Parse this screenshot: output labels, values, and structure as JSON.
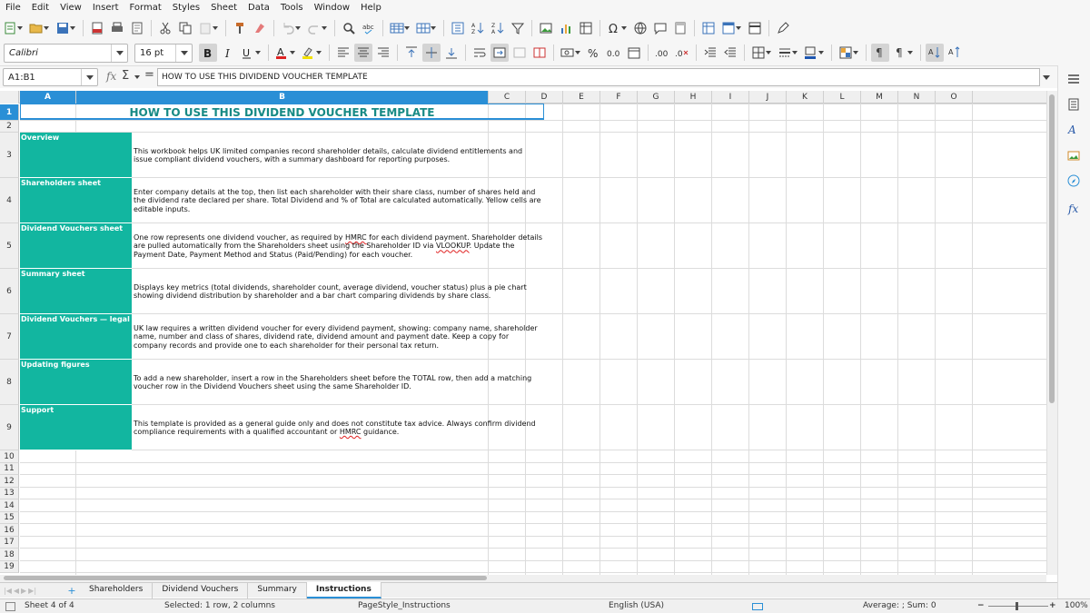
{
  "menu": [
    "File",
    "Edit",
    "View",
    "Insert",
    "Format",
    "Styles",
    "Sheet",
    "Data",
    "Tools",
    "Window",
    "Help"
  ],
  "font": {
    "name": "Calibri",
    "size": "16 pt"
  },
  "formula_bar": {
    "name_box": "A1:B1",
    "content": "HOW TO USE THIS DIVIDEND VOUCHER TEMPLATE"
  },
  "columns": [
    "A",
    "B",
    "C",
    "D",
    "E",
    "F",
    "G",
    "H",
    "I",
    "J",
    "K",
    "L",
    "M",
    "N",
    "O"
  ],
  "rows": [
    "1",
    "2",
    "3",
    "4",
    "5",
    "6",
    "7",
    "8",
    "9",
    "10",
    "11",
    "12",
    "13",
    "14",
    "15",
    "16",
    "17",
    "18",
    "19"
  ],
  "sheet": {
    "title": "HOW TO USE THIS DIVIDEND VOUCHER TEMPLATE",
    "sections": [
      {
        "label": "Overview",
        "text": "This workbook helps UK limited companies record shareholder details, calculate dividend entitlements and issue compliant dividend vouchers, with a summary dashboard for reporting purposes."
      },
      {
        "label": "Shareholders sheet",
        "text": "Enter company details at the top, then list each shareholder with their share class, number of shares held and the dividend rate declared per share. Total Dividend and % of Total are calculated automatically. Yellow cells are editable inputs."
      },
      {
        "label": "Dividend Vouchers sheet",
        "text": "One row represents one dividend voucher, as required by HMRC for each dividend payment. Shareholder details are pulled automatically from the Shareholders sheet using the Shareholder ID via VLOOKUP. Update the Payment Date, Payment Method and Status (Paid/Pending) for each voucher."
      },
      {
        "label": "Summary sheet",
        "text": "Displays key metrics (total dividends, shareholder count, average dividend, voucher status) plus a pie chart showing dividend distribution by shareholder and a bar chart comparing dividends by share class."
      },
      {
        "label": "Dividend Vouchers — legal requir",
        "text": "UK law requires a written dividend voucher for every dividend payment, showing: company name, shareholder name, number and class of shares, dividend rate, dividend amount and payment date. Keep a copy for company records and provide one to each shareholder for their personal tax return."
      },
      {
        "label": "Updating figures",
        "text": "To add a new shareholder, insert a row in the Shareholders sheet before the TOTAL row, then add a matching voucher row in the Dividend Vouchers sheet using the same Shareholder ID."
      },
      {
        "label": "Support",
        "text": "This template is provided as a general guide only and does not constitute tax advice. Always confirm dividend compliance requirements with a qualified accountant or HMRC guidance."
      }
    ]
  },
  "tabs": [
    "Shareholders",
    "Dividend Vouchers",
    "Summary",
    "Instructions"
  ],
  "active_tab": "Instructions",
  "status": {
    "sheet": "Sheet 4 of 4",
    "selection": "Selected: 1 row, 2 columns",
    "page_style": "PageStyle_Instructions",
    "language": "English (USA)",
    "sum": "Average: ; Sum: 0",
    "zoom": "100%"
  },
  "colors": {
    "header_fill": "#12b6a0",
    "title_text": "#178a85",
    "selection": "#2a8fd6"
  }
}
